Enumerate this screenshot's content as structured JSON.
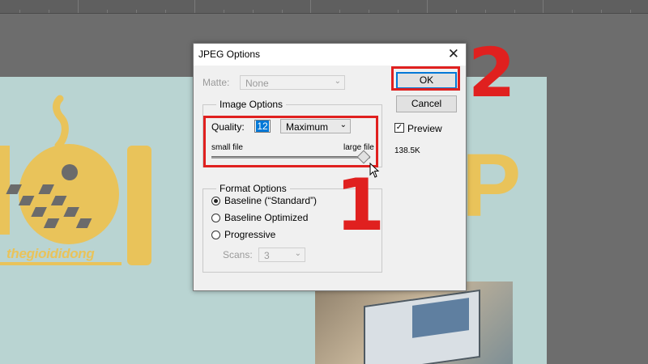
{
  "dialog": {
    "title": "JPEG Options",
    "close_glyph": "✕",
    "matte_label": "Matte:",
    "matte_value": "None",
    "ok_label": "OK",
    "cancel_label": "Cancel",
    "preview_label": "Preview",
    "preview_checked": true,
    "file_size": "138.5K",
    "image_options": {
      "title": "Image Options",
      "quality_label": "Quality:",
      "quality_value": "12",
      "quality_preset": "Maximum",
      "slider_min_label": "small file",
      "slider_max_label": "large file",
      "slider_level": 1.0
    },
    "format_options": {
      "title": "Format Options",
      "options": [
        "Baseline (“Standard”)",
        "Baseline Optimized",
        "Progressive"
      ],
      "selected_index": 0,
      "scans_label": "Scans:",
      "scans_value": "3"
    }
  },
  "background": {
    "brand_text": "thegioididong"
  },
  "annotations": {
    "step1": "1",
    "step2": "2",
    "red": "#e0201f"
  }
}
